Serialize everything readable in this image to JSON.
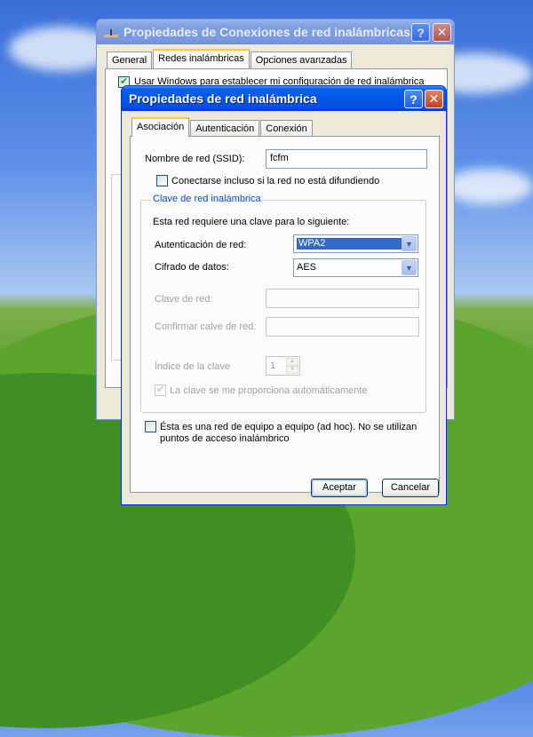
{
  "back_window": {
    "title": "Propiedades de Conexiones de red inalámbricas",
    "tabs": [
      "General",
      "Redes inalámbricas",
      "Opciones avanzadas"
    ],
    "partial_text": "Usar Windows para establecer mi configuración de red inalámbrica"
  },
  "front_window": {
    "title": "Propiedades de red inalámbrica",
    "help_glyph": "?",
    "close_glyph": "✕",
    "tabs": [
      "Asociación",
      "Autenticación",
      "Conexión"
    ],
    "ssid_label": "Nombre de red (SSID):",
    "ssid_value": "fcfm",
    "broadcast_checkbox_label": "Conectarse incluso si la red no está difundiendo",
    "key_group_title": "Clave de red inalámbrica",
    "key_intro": "Esta red requiere una clave para lo siguiente:",
    "auth_label": "Autenticación de red:",
    "auth_value": "WPA2",
    "cipher_label": "Cifrado de datos:",
    "cipher_value": "AES",
    "network_key_label": "Clave de red:",
    "confirm_key_label": "Confirmar calve de red:",
    "key_index_label": "Índice de la clave",
    "key_index_value": "1",
    "auto_key_label": "La clave se me proporciona automáticamente",
    "adhoc_label_line1": "Ésta es una red de equipo a equipo (ad hoc). No se utilizan",
    "adhoc_label_line2": "puntos de acceso inalámbrico",
    "ok_button": "Aceptar",
    "cancel_button": "Cancelar"
  },
  "colors": {
    "titlebar_active": "#0058e8",
    "window_face": "#ece9d8",
    "group_title": "#0046d5",
    "selection": "#316ac5"
  }
}
